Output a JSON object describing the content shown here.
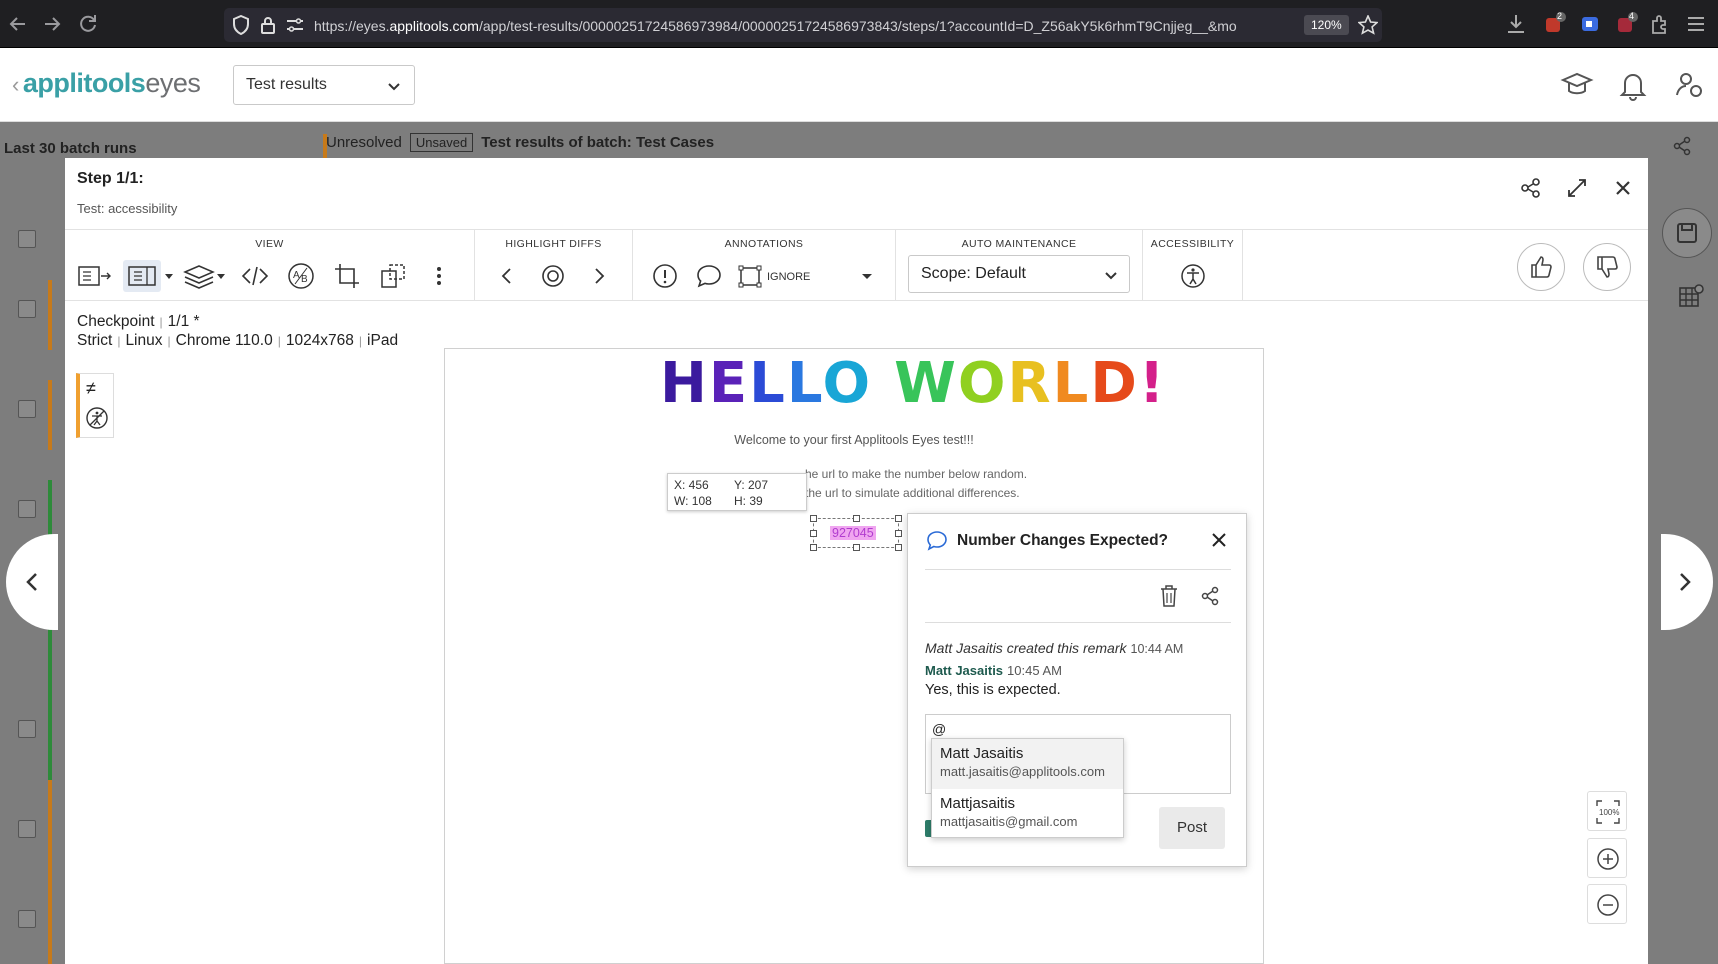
{
  "browser": {
    "url_prefix": "https://eyes.",
    "url_host": "applitools.com",
    "url_rest": "/app/test-results/00000251724586973984/00000251724586973843/steps/1?accountId=D_Z56akY5k6rhmT9Cnjjeg__&mo",
    "zoom": "120%",
    "badge_a": "2",
    "badge_b": "4"
  },
  "app": {
    "logo_main": "applitools",
    "logo_sub": "eyes",
    "selector": "Test results"
  },
  "background": {
    "panel_title": "Last 30 batch runs",
    "status": "Unresolved",
    "saved_state": "Unsaved",
    "batch_label": "Test results of batch:",
    "batch_name": "Test Cases"
  },
  "step": {
    "title": "Step 1/1:",
    "subtitle": "Test: accessibility"
  },
  "toolbar": {
    "view": "VIEW",
    "highlight": "HIGHLIGHT DIFFS",
    "annotations": "ANNOTATIONS",
    "ignore": "IGNORE",
    "auto": "AUTO MAINTENANCE",
    "scope": "Scope: Default",
    "accessibility": "ACCESSIBILITY"
  },
  "checkpoint": {
    "label": "Checkpoint",
    "index": "1/1",
    "star": "*",
    "match": "Strict",
    "os": "Linux",
    "browser": "Chrome 110.0",
    "viewport": "1024x768",
    "device": "iPad"
  },
  "screenshot": {
    "hello": [
      "H",
      "E",
      "L",
      "L",
      "O",
      " ",
      "W",
      "O",
      "R",
      "L",
      "D",
      "!"
    ],
    "hello_colors": [
      "#3b1a9e",
      "#5a22b8",
      "#2b4bd6",
      "#2a78e0",
      "#19a6d6",
      "#fff",
      "#38c45a",
      "#90d020",
      "#e8c020",
      "#f08a20",
      "#e64a1a",
      "#d4208a"
    ],
    "welcome": "Welcome to your first Applitools Eyes test!!!",
    "line1": "he url to make the number below random.",
    "line2": "the url to simulate additional differences.",
    "x": "X: 456",
    "y": "Y: 207",
    "w": "W: 108",
    "h": "H: 39",
    "number": "927045"
  },
  "remark": {
    "title": "Number Changes Expected?",
    "created_by": "Matt Jasaitis created this remark",
    "created_time": "10:44 AM",
    "author": "Matt Jasaitis",
    "reply_time": "10:45 AM",
    "reply": "Yes, this is expected.",
    "input_value": "@",
    "post": "Post"
  },
  "mentions": [
    {
      "name": "Matt Jasaitis",
      "email": "matt.jasaitis@applitools.com"
    },
    {
      "name": "Mattjasaitis",
      "email": "mattjasaitis@gmail.com"
    }
  ],
  "zoom": {
    "fit": "100%"
  },
  "colors": {
    "accent": "#3aa0a6",
    "orange": "#f0a030",
    "green": "#2e8b3a"
  }
}
